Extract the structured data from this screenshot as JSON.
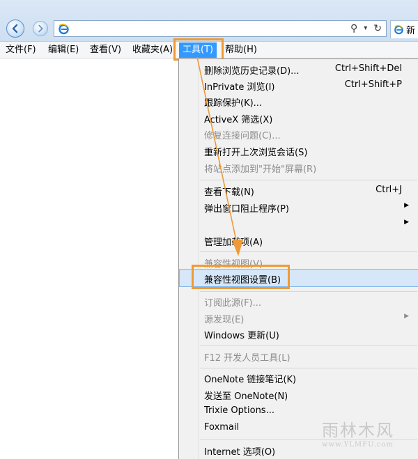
{
  "toolbar": {
    "back_icon": "back-arrow-icon",
    "forward_icon": "forward-arrow-icon",
    "address_icon": "ie-icon",
    "address_value": "",
    "search_icon": "search-icon",
    "dropdown_icon": "chevron-down-icon",
    "refresh_icon": "refresh-icon",
    "tab_label": "新"
  },
  "menubar": {
    "items": [
      "文件(F)",
      "编辑(E)",
      "查看(V)",
      "收藏夹(A)",
      "工具(T)",
      "帮助(H)"
    ],
    "active_index": 4
  },
  "tools_menu": {
    "items": [
      {
        "label": "删除浏览历史记录(D)...",
        "shortcut": "Ctrl+Shift+Del"
      },
      {
        "label": "InPrivate 浏览(I)",
        "shortcut": "Ctrl+Shift+P"
      },
      {
        "label": "跟踪保护(K)..."
      },
      {
        "label": "ActiveX 筛选(X)"
      },
      {
        "label": "修复连接问题(C)...",
        "disabled": true
      },
      {
        "label": "重新打开上次浏览会话(S)"
      },
      {
        "label": "将站点添加到\"开始\"屏幕(R)",
        "disabled": true
      },
      {
        "label": "查看下载(N)",
        "shortcut": "Ctrl+J"
      },
      {
        "label": "弹出窗口阻止程序(P)",
        "submenu": true
      },
      {
        "label": "",
        "submenu": true
      },
      {
        "label": "管理加载项(A)"
      },
      {
        "label": "兼容性视图(V)",
        "disabled": true
      },
      {
        "label": "兼容性视图设置(B)",
        "highlighted": true
      },
      {
        "label": "订阅此源(F)...",
        "disabled": true
      },
      {
        "label": "源发现(E)",
        "disabled": true,
        "submenu": true
      },
      {
        "label": "Windows 更新(U)"
      },
      {
        "label": "F12 开发人员工具(L)",
        "disabled": true
      },
      {
        "label": "OneNote 链接笔记(K)"
      },
      {
        "label": "发送至 OneNote(N)"
      },
      {
        "label": "Trixie Options..."
      },
      {
        "label": "Foxmail"
      },
      {
        "label": "Internet 选项(O)"
      }
    ]
  },
  "colors": {
    "highlight_box": "#ef9a36",
    "menu_active": "#3399ff",
    "hover_row": "#d5e7f8"
  },
  "watermark": {
    "line1": "雨林木风",
    "line2": "www.YLMFU.com"
  }
}
